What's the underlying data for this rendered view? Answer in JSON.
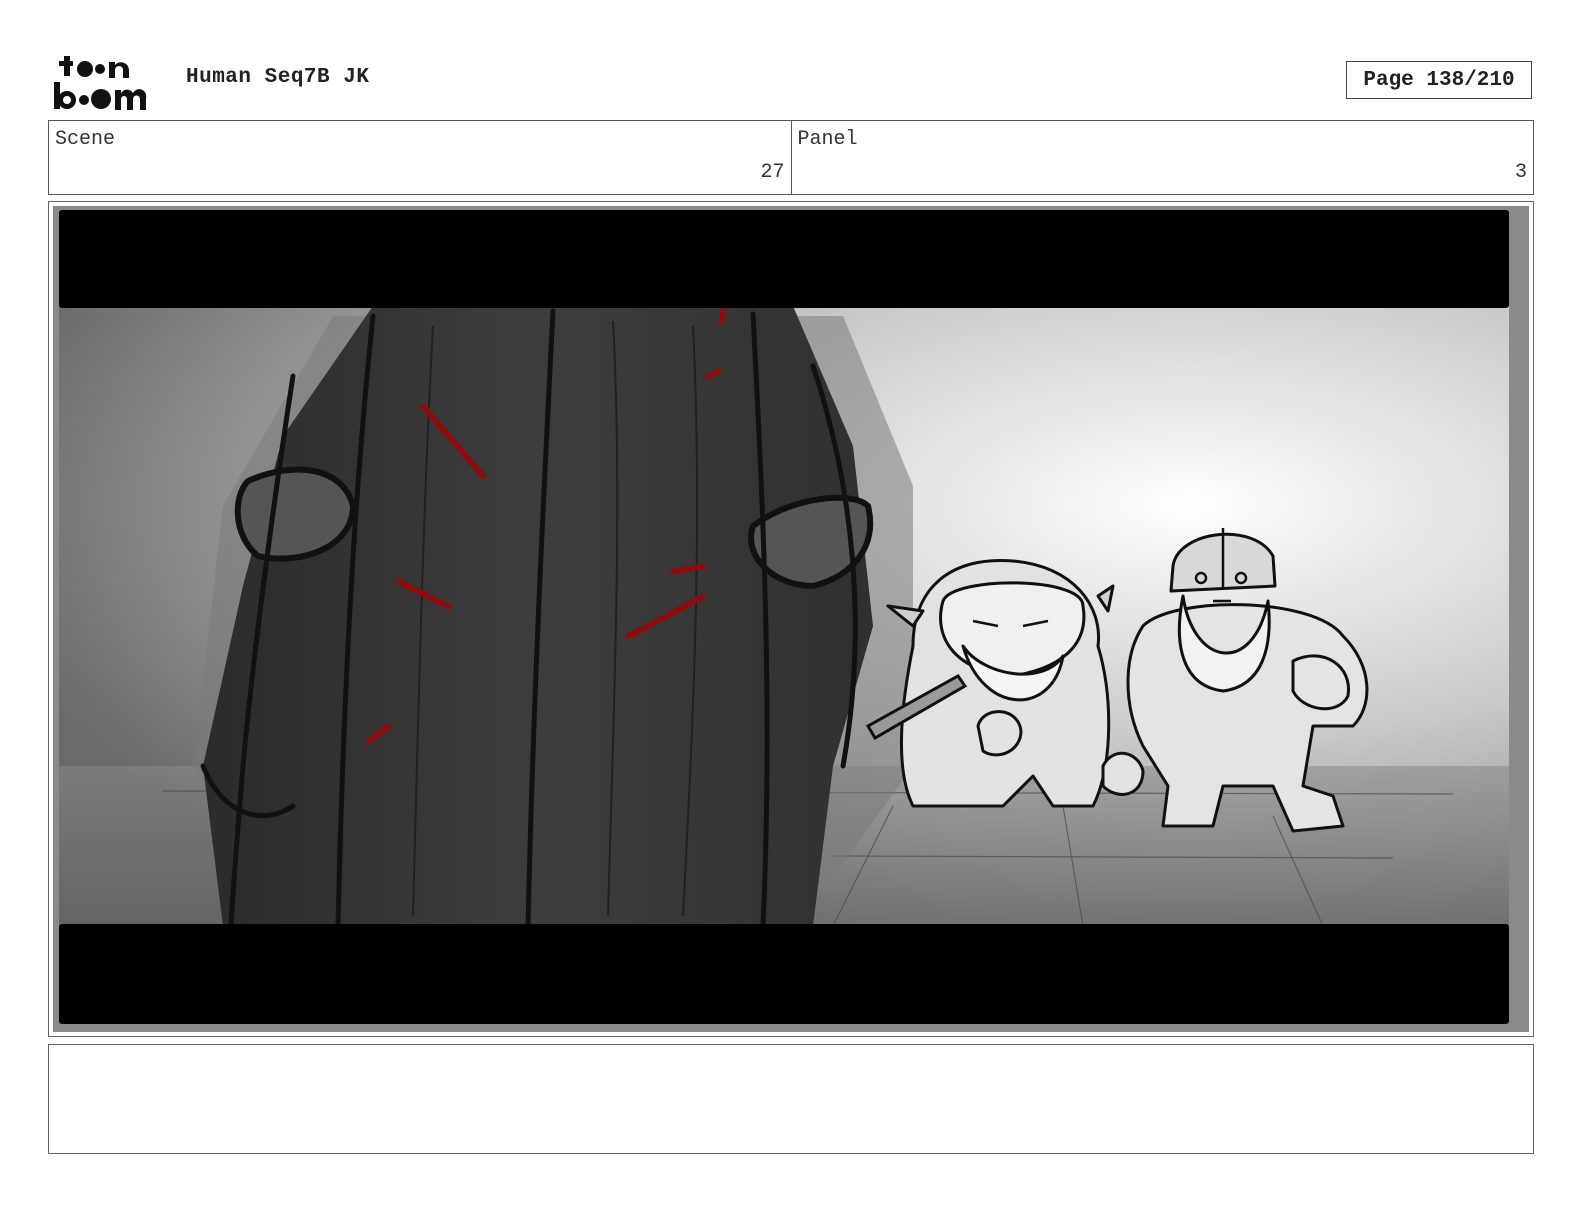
{
  "header": {
    "logo_icon": "toonboom-logo-icon",
    "title": "Human Seq7B JK",
    "page_label": "Page 138/210"
  },
  "info": {
    "scene_label": "Scene",
    "scene_value": "27",
    "panel_label": "Panel",
    "panel_value": "3"
  },
  "panel": {
    "image_icon": "storyboard-sketch-image",
    "letterbox_color": "#000000",
    "blood_color": "#8b0d0d"
  },
  "notes": {
    "text": ""
  }
}
